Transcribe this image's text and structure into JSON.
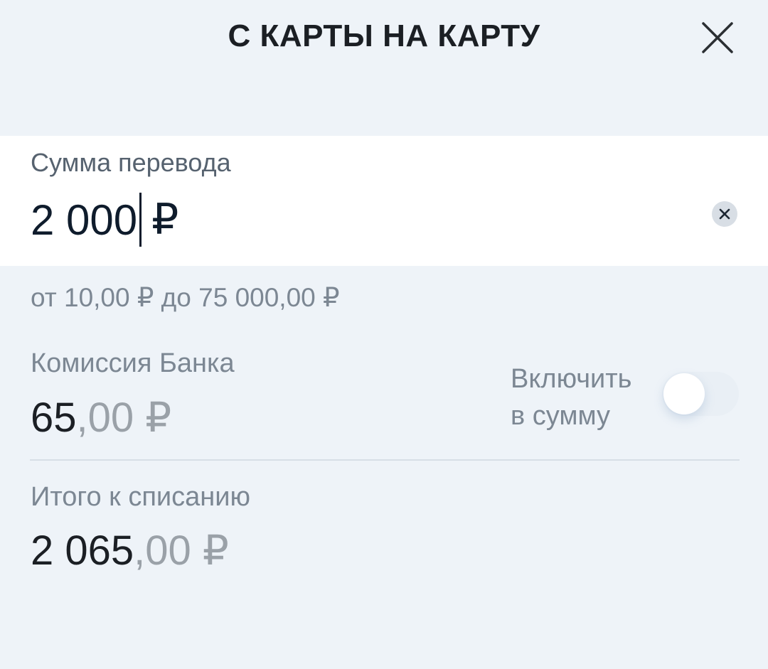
{
  "header": {
    "title": "С КАРТЫ НА КАРТУ",
    "close_icon": "close-icon"
  },
  "amount": {
    "label": "Сумма перевода",
    "value": "2 000",
    "currency": "₽",
    "clear_icon": "clear-icon"
  },
  "limits": {
    "text": "от 10,00 ₽ до 75 000,00 ₽"
  },
  "fee": {
    "label": "Комиссия Банка",
    "integer": "65",
    "fraction": ",00 ₽"
  },
  "include": {
    "line1": "Включить",
    "line2": "в сумму",
    "enabled": false
  },
  "total": {
    "label": "Итого к списанию",
    "integer": "2 065",
    "fraction": ",00 ₽"
  },
  "colors": {
    "background": "#eef3f8",
    "panel": "#ffffff",
    "text_primary": "#1b1f24",
    "text_secondary": "#7c8793",
    "text_muted": "#9aa1a8"
  }
}
